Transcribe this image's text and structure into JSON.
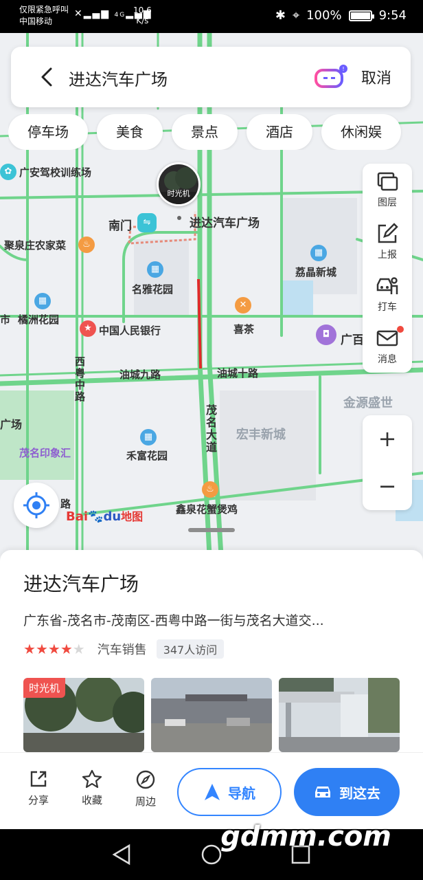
{
  "status_bar": {
    "carrier_line1": "仅限紧急呼叫",
    "carrier_line2": "中国移动",
    "signal": "4G",
    "speed_value": "10.6",
    "speed_unit": "K/s",
    "battery": "100%",
    "time": "9:54"
  },
  "search": {
    "query": "进达汽车广场",
    "cancel_label": "取消"
  },
  "chips": [
    "停车场",
    "美食",
    "景点",
    "酒店",
    "休闲娱"
  ],
  "tools": [
    {
      "label": "图层",
      "icon": "layers-icon"
    },
    {
      "label": "上报",
      "icon": "report-icon"
    },
    {
      "label": "打车",
      "icon": "taxi-icon"
    },
    {
      "label": "消息",
      "icon": "message-icon"
    }
  ],
  "zoom": {
    "in": "+",
    "out": "−"
  },
  "map": {
    "labels": {
      "guangan": "广安驾校训练场",
      "nanmen": "南门",
      "jinda": "进达汽车广场",
      "juquan": "聚泉庄农家菜",
      "mingya": "名雅花园",
      "lijing": "荔晶新城",
      "juzhou": "橘洲花园",
      "shi": "市",
      "bank": "中国人民银行",
      "xicha": "喜茶",
      "guangbai": "广百",
      "youcheng9": "油城九路",
      "youcheng10": "油城十路",
      "xiyue": "西粤中路",
      "jinyuan": "金源盛世",
      "maoming_dadao": "茂名大道",
      "hongfeng": "宏丰新城",
      "guang": "广场",
      "yinxiang": "茂名印象汇",
      "hefu": "禾富花园",
      "xinquan": "鑫泉花蟹煲鸡",
      "lu": "路",
      "timemachine": "时光机"
    },
    "logo_bai": "Bai",
    "logo_du": "du",
    "logo_ditu": "地图"
  },
  "place": {
    "title": "进达汽车广场",
    "address": "广东省-茂名市-茂南区-西粤中路一街与茂名大道交...",
    "rating": 4,
    "category": "汽车销售",
    "visits": "347人访问",
    "photo_tag": "时光机"
  },
  "actions": {
    "share": "分享",
    "favorite": "收藏",
    "nearby": "周边",
    "navigate": "导航",
    "go_here": "到这去"
  },
  "watermark": "gdmm.com"
}
